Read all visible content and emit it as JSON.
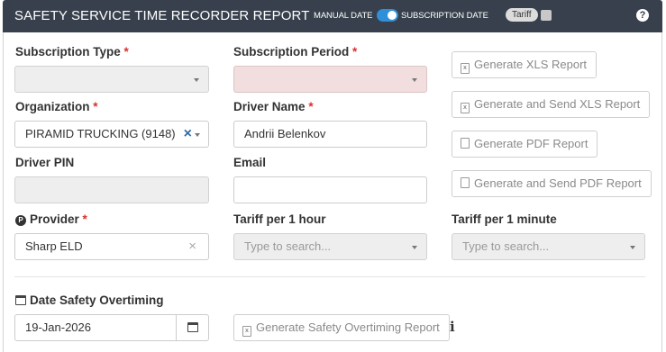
{
  "header": {
    "title": "SAFETY SERVICE TIME RECORDER REPORT",
    "manual_date_label": "MANUAL DATE",
    "subscription_date_label": "SUBSCRIPTION DATE",
    "tariff_label": "Tariff",
    "help_glyph": "?"
  },
  "form": {
    "subscription_type": {
      "label": "Subscription Type",
      "value": ""
    },
    "subscription_period": {
      "label": "Subscription Period",
      "value": ""
    },
    "organization": {
      "label": "Organization",
      "value": "PIRAMID TRUCKING (9148)"
    },
    "driver_name": {
      "label": "Driver Name",
      "value": "Andrii Belenkov"
    },
    "driver_pin": {
      "label": "Driver PIN",
      "value": ""
    },
    "email": {
      "label": "Email",
      "value": ""
    },
    "provider": {
      "label": "Provider",
      "value": "Sharp ELD"
    },
    "tariff_hour": {
      "label": "Tariff per 1 hour",
      "placeholder": "Type to search..."
    },
    "tariff_minute": {
      "label": "Tariff per 1 minute",
      "placeholder": "Type to search..."
    },
    "required_mark": "*"
  },
  "buttons": {
    "xls": "Generate XLS Report",
    "send_xls": "Generate and Send XLS Report",
    "pdf": "Generate PDF Report",
    "send_pdf": "Generate and Send PDF Report",
    "overtiming": "Generate Safety Overtiming Report"
  },
  "overtiming": {
    "label": "Date Safety Overtiming",
    "date_value": "19-Jan-2026"
  },
  "icons": {
    "clear": "×",
    "provider": "P",
    "info": "i"
  },
  "colors": {
    "header_bg": "#37404c",
    "toggle": "#2f8fd8",
    "required": "#d9302c",
    "clear_org": "#2e6da4",
    "invalid_bg": "#f2dede"
  }
}
